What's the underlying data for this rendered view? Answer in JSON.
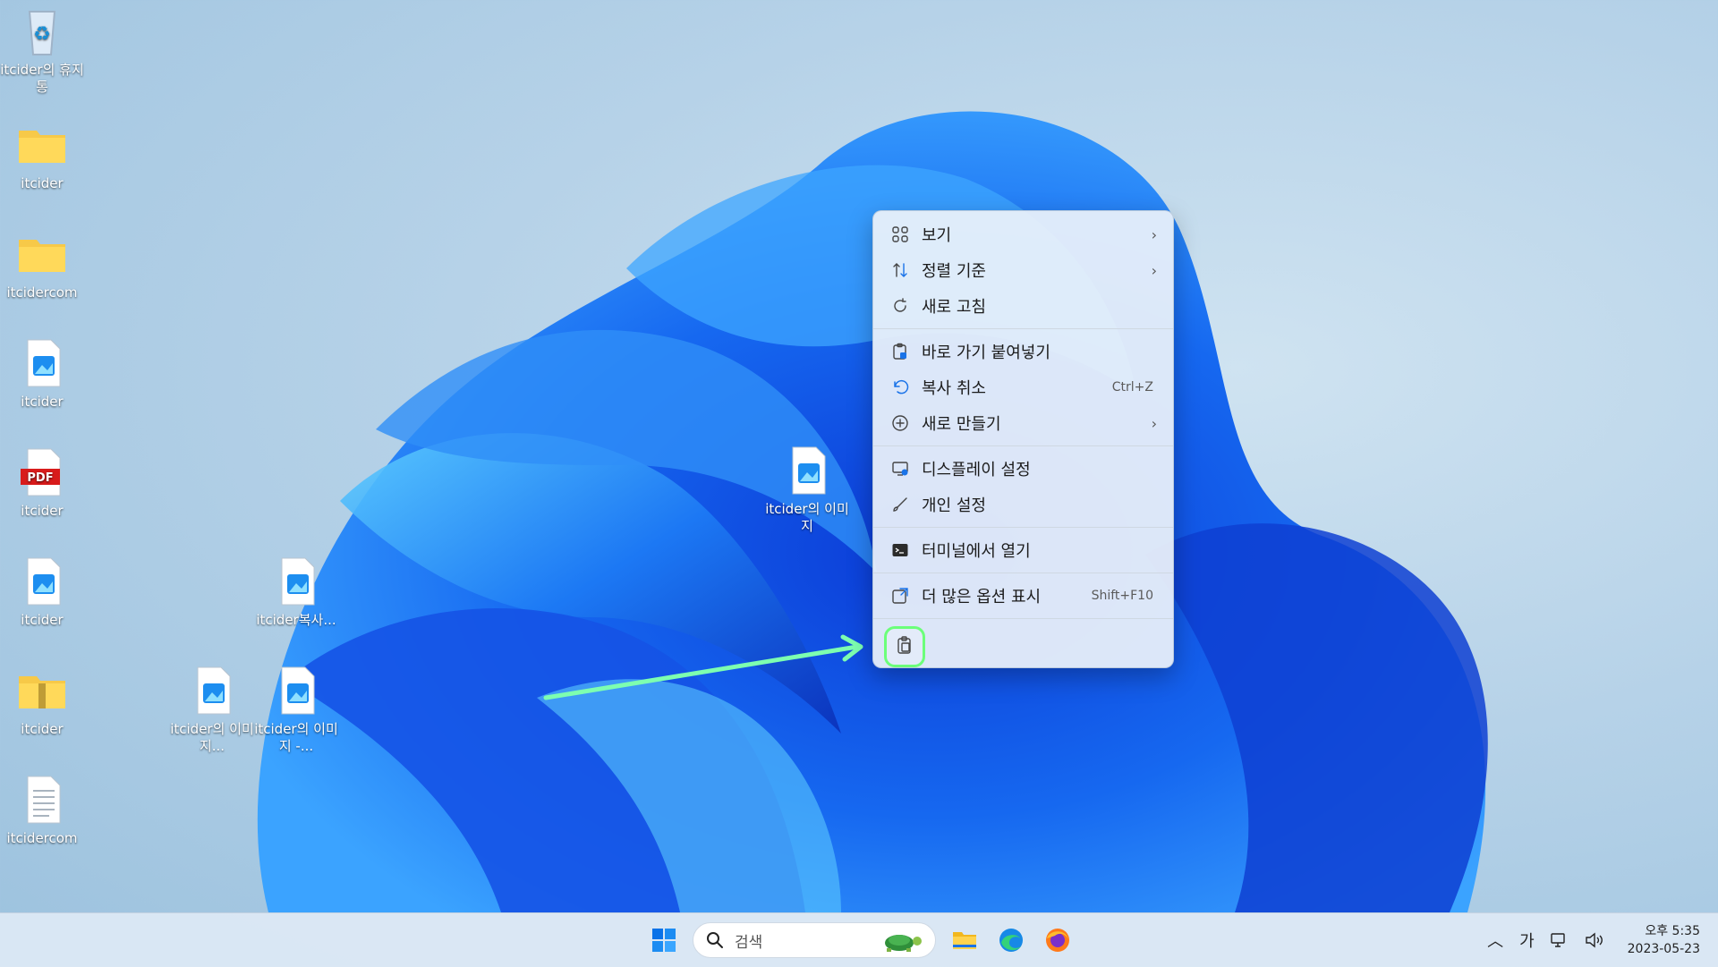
{
  "desktop": {
    "icons": [
      {
        "label": "itcider의 휴지통"
      },
      {
        "label": "itcider"
      },
      {
        "label": "itcidercom"
      },
      {
        "label": "itcider"
      },
      {
        "label": "itcider",
        "badge": "PDF"
      },
      {
        "label": "itcider"
      },
      {
        "label": "itcider"
      },
      {
        "label": "itcidercom"
      },
      {
        "label": "itcider복사..."
      },
      {
        "label": "itcider의 이미지..."
      },
      {
        "label": "itcider의 이미지 -..."
      },
      {
        "label": "itcider의 이미지"
      }
    ]
  },
  "context_menu": {
    "items": [
      {
        "label": "보기",
        "icon": "grid-icon",
        "submenu": true
      },
      {
        "label": "정렬 기준",
        "icon": "sort-icon",
        "submenu": true
      },
      {
        "label": "새로 고침",
        "icon": "refresh-icon"
      },
      {
        "label": "바로 가기 붙여넣기",
        "icon": "paste-shortcut-icon"
      },
      {
        "label": "복사 취소",
        "icon": "undo-icon",
        "shortcut": "Ctrl+Z"
      },
      {
        "label": "새로 만들기",
        "icon": "new-plus-icon",
        "submenu": true
      },
      {
        "label": "디스플레이 설정",
        "icon": "display-icon"
      },
      {
        "label": "개인 설정",
        "icon": "brush-icon"
      },
      {
        "label": "터미널에서 열기",
        "icon": "terminal-icon"
      },
      {
        "label": "더 많은 옵션 표시",
        "icon": "more-options-icon",
        "shortcut": "Shift+F10"
      }
    ],
    "highlight_color": "#6cff7a"
  },
  "taskbar": {
    "search_placeholder": "검색",
    "apps": [
      "windows-start-icon",
      "file-explorer-icon",
      "edge-icon",
      "firefox-icon"
    ],
    "ime": "가",
    "clock_time": "오후 5:35",
    "clock_date": "2023-05-23"
  }
}
